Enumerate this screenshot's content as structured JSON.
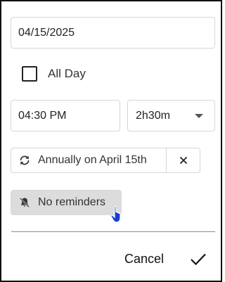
{
  "date": {
    "value": "04/15/2025"
  },
  "all_day": {
    "label": "All Day",
    "checked": false
  },
  "time": {
    "value": "04:30 PM"
  },
  "duration": {
    "value": "2h30m"
  },
  "recurrence": {
    "label": "Annually on April 15th",
    "icon": "repeat-icon",
    "clear_icon": "close-icon"
  },
  "reminders": {
    "label": "No reminders",
    "icon": "bell-off-icon"
  },
  "actions": {
    "cancel_label": "Cancel",
    "confirm_icon": "check-icon"
  },
  "colors": {
    "border": "#d6d6d6",
    "reminder_bg": "#dcdcdc",
    "cursor": "#1a3fd6"
  }
}
